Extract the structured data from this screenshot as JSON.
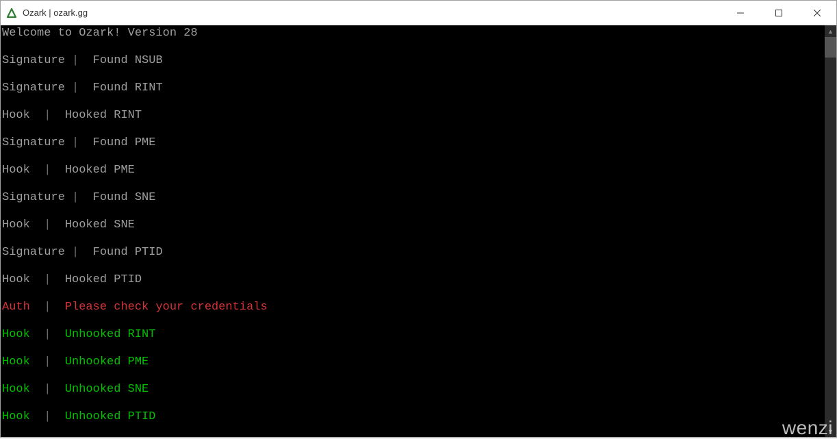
{
  "window": {
    "title": "Ozark | ozark.gg"
  },
  "console": {
    "welcome": "Welcome to Ozark! Version 28",
    "lines": [
      {
        "category": "Signature",
        "message": " Found NSUB",
        "color": "default"
      },
      {
        "category": "Signature",
        "message": " Found RINT",
        "color": "default"
      },
      {
        "category": "Hook ",
        "message": " Hooked RINT",
        "color": "default"
      },
      {
        "category": "Signature",
        "message": " Found PME",
        "color": "default"
      },
      {
        "category": "Hook ",
        "message": " Hooked PME",
        "color": "default"
      },
      {
        "category": "Signature",
        "message": " Found SNE",
        "color": "default"
      },
      {
        "category": "Hook ",
        "message": " Hooked SNE",
        "color": "default"
      },
      {
        "category": "Signature",
        "message": " Found PTID",
        "color": "default"
      },
      {
        "category": "Hook ",
        "message": " Hooked PTID",
        "color": "default"
      },
      {
        "category": "Auth ",
        "message": " Please check your credentials",
        "color": "red"
      },
      {
        "category": "Hook ",
        "message": " Unhooked RINT",
        "color": "green"
      },
      {
        "category": "Hook ",
        "message": " Unhooked PME",
        "color": "green"
      },
      {
        "category": "Hook ",
        "message": " Unhooked SNE",
        "color": "green"
      },
      {
        "category": "Hook ",
        "message": " Unhooked PTID",
        "color": "green"
      }
    ]
  },
  "watermark": "wenzi"
}
